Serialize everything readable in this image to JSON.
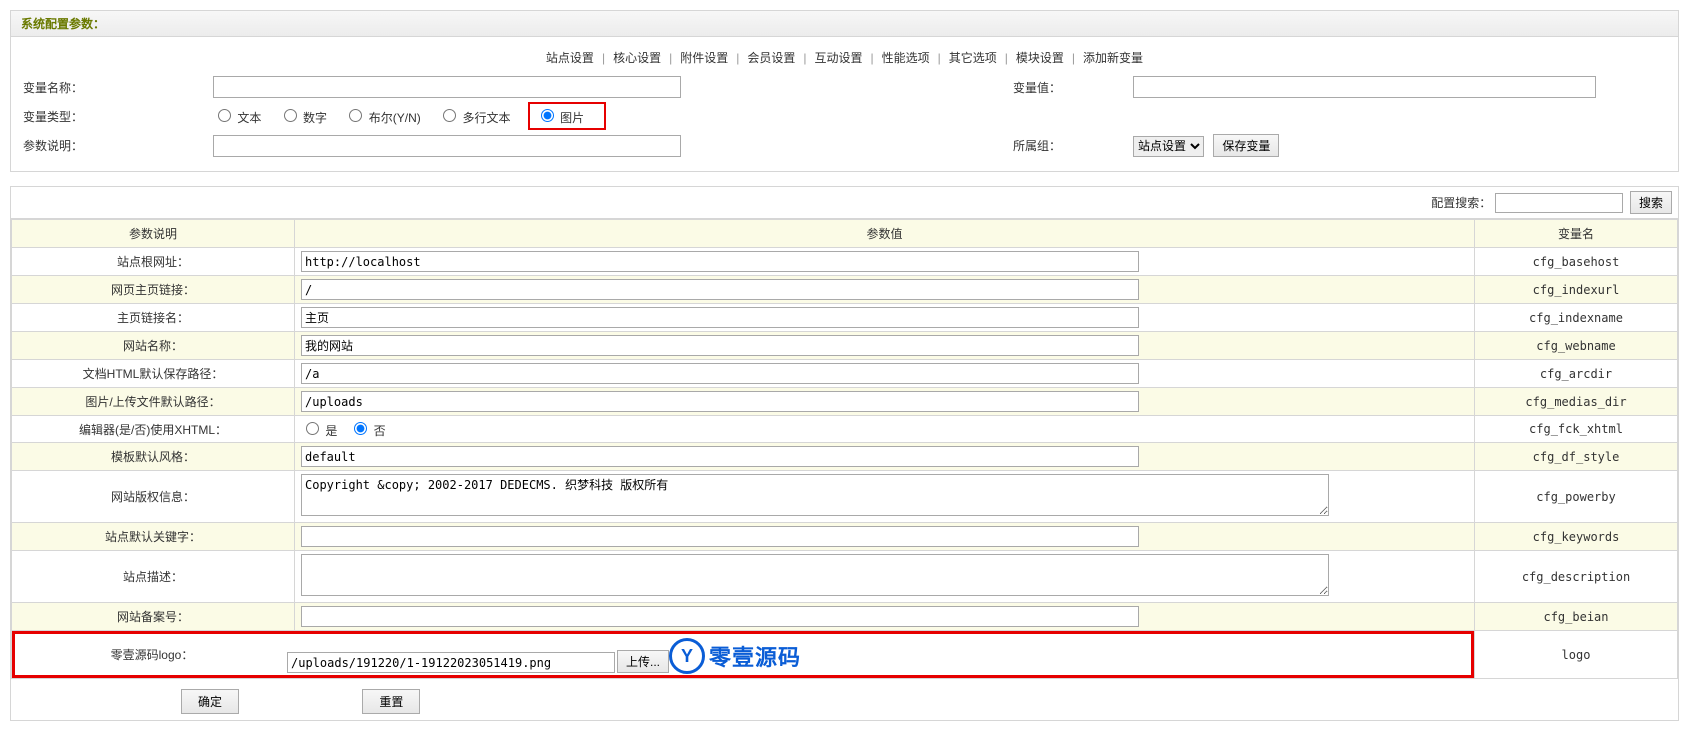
{
  "page_title": "系统配置参数：",
  "nav": {
    "items": [
      "站点设置",
      "核心设置",
      "附件设置",
      "会员设置",
      "互动设置",
      "性能选项",
      "其它选项",
      "模块设置",
      "添加新变量"
    ]
  },
  "form": {
    "var_name_label": "变量名称：",
    "var_name_value": "",
    "var_value_label": "变量值：",
    "var_value_value": "",
    "var_type_label": "变量类型：",
    "types": {
      "text": "文本",
      "number": "数字",
      "bool": "布尔(Y/N)",
      "mtext": "多行文本",
      "image": "图片"
    },
    "param_desc_label": "参数说明：",
    "param_desc_value": "",
    "group_label": "所属组：",
    "group_selected": "站点设置",
    "save_btn": "保存变量"
  },
  "search": {
    "label": "配置搜索：",
    "value": "",
    "btn": "搜索"
  },
  "table": {
    "head": {
      "desc": "参数说明",
      "val": "参数值",
      "var": "变量名"
    },
    "rows": [
      {
        "desc": "站点根网址：",
        "var": "cfg_basehost",
        "type": "text",
        "value": "http://localhost"
      },
      {
        "desc": "网页主页链接：",
        "var": "cfg_indexurl",
        "type": "text",
        "value": "/"
      },
      {
        "desc": "主页链接名：",
        "var": "cfg_indexname",
        "type": "text",
        "value": "主页"
      },
      {
        "desc": "网站名称：",
        "var": "cfg_webname",
        "type": "text",
        "value": "我的网站"
      },
      {
        "desc": "文档HTML默认保存路径：",
        "var": "cfg_arcdir",
        "type": "text",
        "value": "/a"
      },
      {
        "desc": "图片/上传文件默认路径：",
        "var": "cfg_medias_dir",
        "type": "text",
        "value": "/uploads"
      },
      {
        "desc": "编辑器(是/否)使用XHTML：",
        "var": "cfg_fck_xhtml",
        "type": "radio",
        "value": "否",
        "opts": {
          "yes": "是",
          "no": "否"
        }
      },
      {
        "desc": "模板默认风格：",
        "var": "cfg_df_style",
        "type": "text",
        "value": "default"
      },
      {
        "desc": "网站版权信息：",
        "var": "cfg_powerby",
        "type": "textarea",
        "value": "Copyright &copy; 2002-2017 DEDECMS. 织梦科技 版权所有"
      },
      {
        "desc": "站点默认关键字：",
        "var": "cfg_keywords",
        "type": "text",
        "value": ""
      },
      {
        "desc": "站点描述：",
        "var": "cfg_description",
        "type": "textarea",
        "value": ""
      },
      {
        "desc": "网站备案号：",
        "var": "cfg_beian",
        "type": "text",
        "value": ""
      },
      {
        "desc": "零壹源码logo：",
        "var": "logo",
        "type": "upload",
        "value": "/uploads/191220/1-19122023051419.png",
        "upload_btn": "上传...",
        "watermark": "零壹源码"
      }
    ]
  },
  "actions": {
    "ok": "确定",
    "reset": "重置"
  },
  "form_gap_label": ""
}
